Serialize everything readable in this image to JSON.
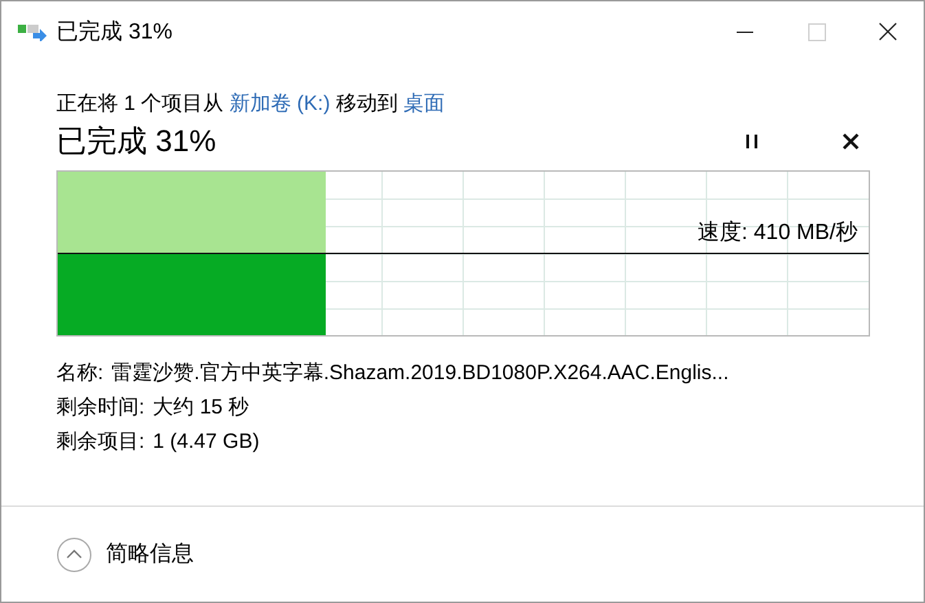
{
  "window": {
    "title": "已完成 31%",
    "maximize_disabled": true
  },
  "header": [
    {
      "kind": "text",
      "text": "正在将 1 个项目从 "
    },
    {
      "kind": "link",
      "text": "新加卷 (K:)"
    },
    {
      "kind": "text",
      "text": " 移动到 "
    },
    {
      "kind": "link",
      "text": "桌面"
    }
  ],
  "status": "已完成 31%",
  "progress": {
    "level": 0.33,
    "speed": "速度: 410 MB/秒"
  },
  "details": [
    {
      "label": "名称:",
      "value": "雷霆沙赞.官方中英字幕.Shazam.2019.BD1080P.X264.AAC.Englis..."
    },
    {
      "label": "剩余时间:",
      "value": "大约 15 秒"
    },
    {
      "label": "剩余项目:",
      "value": "1 (4.47 GB)"
    }
  ],
  "footer": {
    "label": "简略信息",
    "expanded": true
  }
}
